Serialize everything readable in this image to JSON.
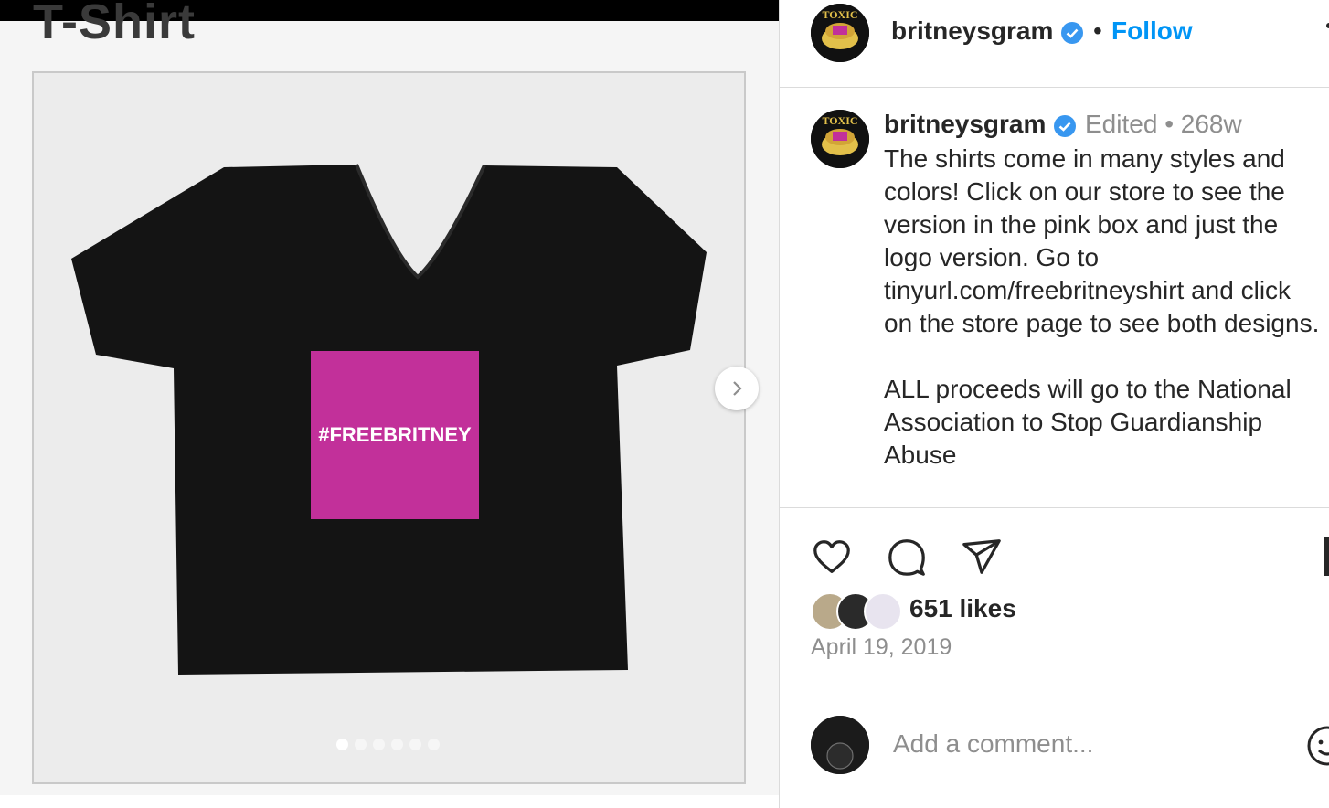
{
  "media": {
    "heading": "T-Shirt",
    "shirt_text": "#FREEBRITNEY",
    "slide_count": 6,
    "active_slide": 1,
    "colors": {
      "shirt": "#141414",
      "box": "#c2309a",
      "frame_bg": "#ececec"
    }
  },
  "header": {
    "username": "britneysgram",
    "separator": "•",
    "follow_label": "Follow"
  },
  "caption": {
    "username": "britneysgram",
    "edited": "Edited",
    "separator": "•",
    "age": "268w",
    "text": "The shirts come in many styles and colors! Click on our store to see the version in the pink box and just the logo version. Go to tinyurl.com/freebritneyshirt and click on the store page to see both designs.\n\nALL proceeds will go to the National Association to Stop Guardianship Abuse"
  },
  "engagement": {
    "likes": "651 likes",
    "date": "April 19, 2019"
  },
  "comment": {
    "placeholder": "Add a comment..."
  },
  "icons": [
    "heart-icon",
    "comment-icon",
    "share-icon",
    "bookmark-icon",
    "emoji-icon",
    "chevron-right-icon",
    "verified-badge-icon"
  ],
  "accent": "#0095f6"
}
